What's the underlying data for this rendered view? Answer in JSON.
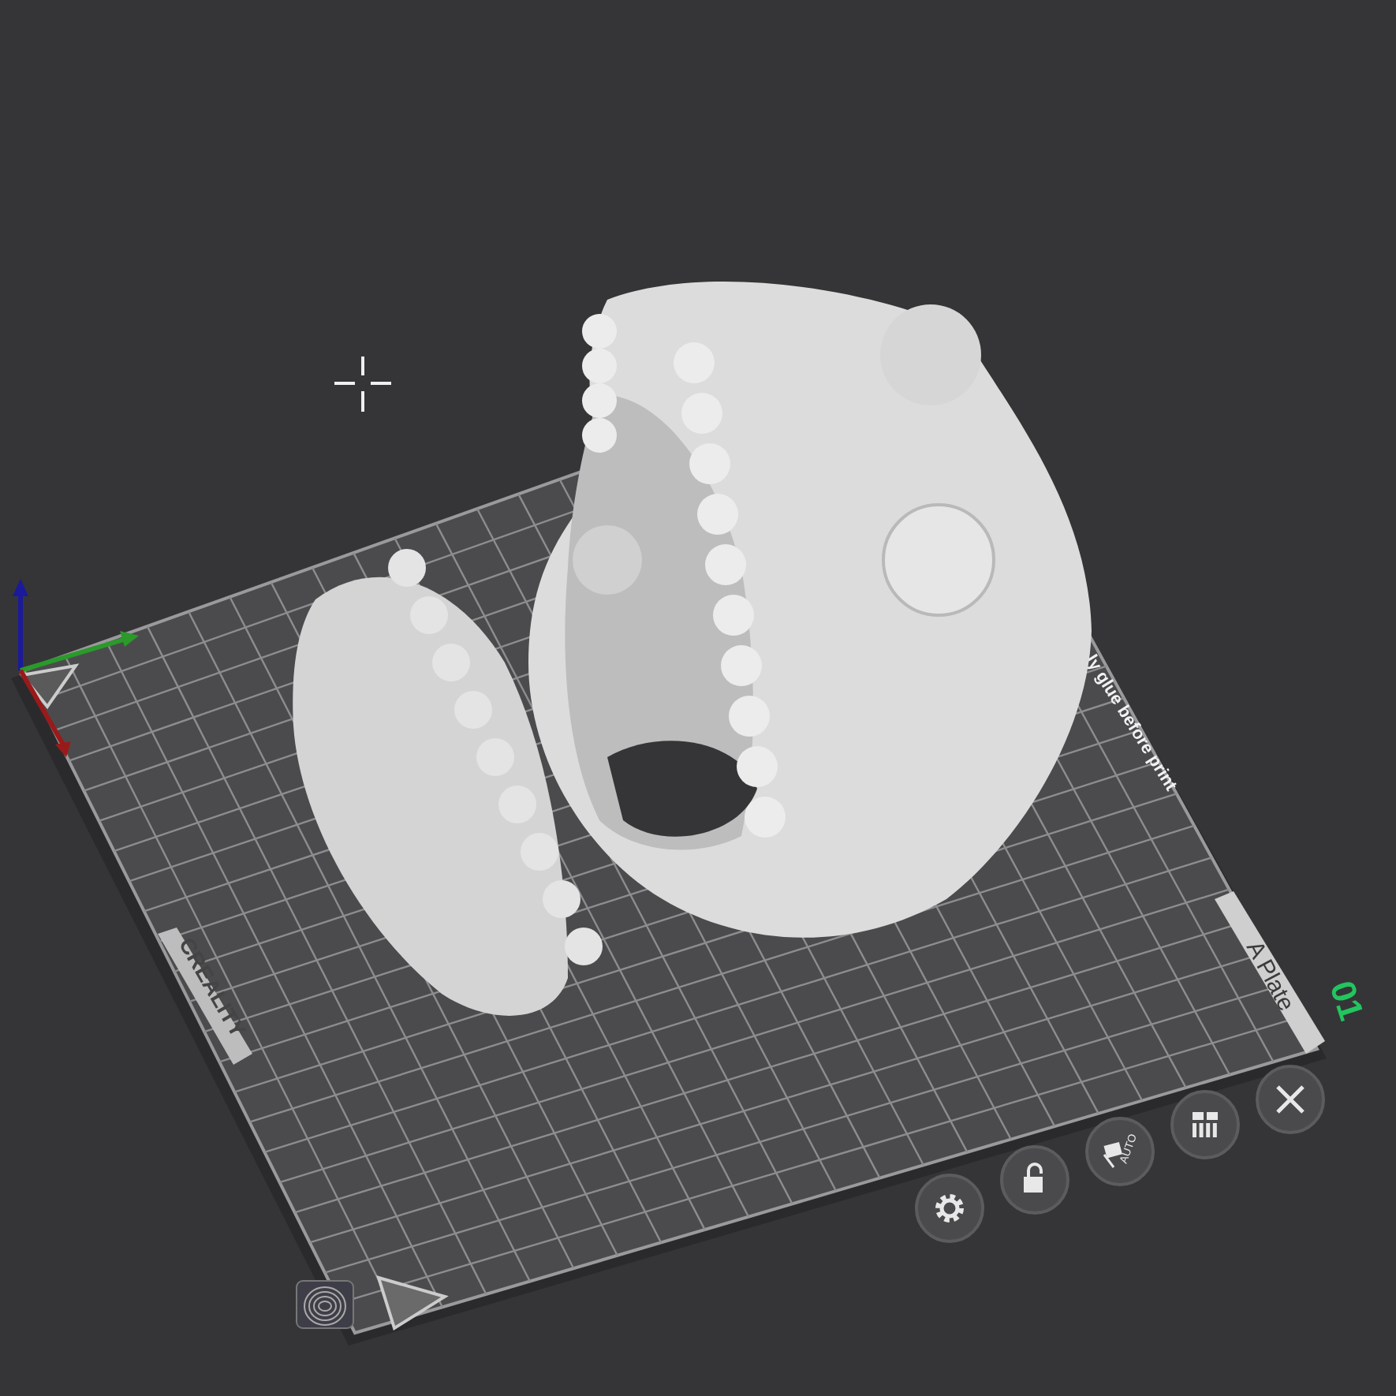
{
  "plate": {
    "number": "01",
    "name": "A Plate"
  },
  "bed": {
    "logo": "CREALITY",
    "edge_note": "ly glue before print"
  },
  "toolbar": [
    {
      "kind": "settings"
    },
    {
      "kind": "lock"
    },
    {
      "kind": "auto-arrange",
      "label": "AUTO"
    },
    {
      "kind": "layout"
    },
    {
      "kind": "close"
    }
  ]
}
